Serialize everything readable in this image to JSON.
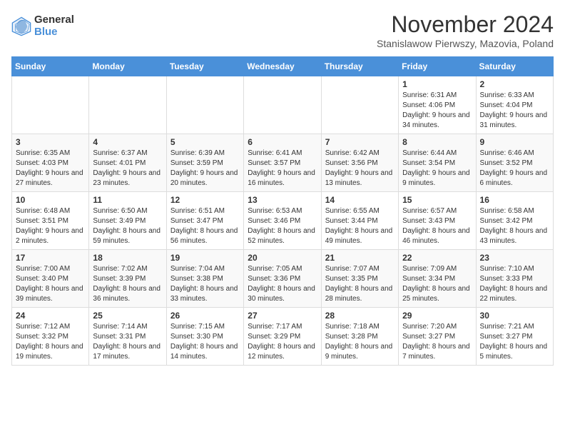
{
  "logo": {
    "general": "General",
    "blue": "Blue"
  },
  "title": "November 2024",
  "subtitle": "Stanislawow Pierwszy, Mazovia, Poland",
  "headers": [
    "Sunday",
    "Monday",
    "Tuesday",
    "Wednesday",
    "Thursday",
    "Friday",
    "Saturday"
  ],
  "weeks": [
    [
      {
        "day": "",
        "info": ""
      },
      {
        "day": "",
        "info": ""
      },
      {
        "day": "",
        "info": ""
      },
      {
        "day": "",
        "info": ""
      },
      {
        "day": "",
        "info": ""
      },
      {
        "day": "1",
        "info": "Sunrise: 6:31 AM\nSunset: 4:06 PM\nDaylight: 9 hours and 34 minutes."
      },
      {
        "day": "2",
        "info": "Sunrise: 6:33 AM\nSunset: 4:04 PM\nDaylight: 9 hours and 31 minutes."
      }
    ],
    [
      {
        "day": "3",
        "info": "Sunrise: 6:35 AM\nSunset: 4:03 PM\nDaylight: 9 hours and 27 minutes."
      },
      {
        "day": "4",
        "info": "Sunrise: 6:37 AM\nSunset: 4:01 PM\nDaylight: 9 hours and 23 minutes."
      },
      {
        "day": "5",
        "info": "Sunrise: 6:39 AM\nSunset: 3:59 PM\nDaylight: 9 hours and 20 minutes."
      },
      {
        "day": "6",
        "info": "Sunrise: 6:41 AM\nSunset: 3:57 PM\nDaylight: 9 hours and 16 minutes."
      },
      {
        "day": "7",
        "info": "Sunrise: 6:42 AM\nSunset: 3:56 PM\nDaylight: 9 hours and 13 minutes."
      },
      {
        "day": "8",
        "info": "Sunrise: 6:44 AM\nSunset: 3:54 PM\nDaylight: 9 hours and 9 minutes."
      },
      {
        "day": "9",
        "info": "Sunrise: 6:46 AM\nSunset: 3:52 PM\nDaylight: 9 hours and 6 minutes."
      }
    ],
    [
      {
        "day": "10",
        "info": "Sunrise: 6:48 AM\nSunset: 3:51 PM\nDaylight: 9 hours and 2 minutes."
      },
      {
        "day": "11",
        "info": "Sunrise: 6:50 AM\nSunset: 3:49 PM\nDaylight: 8 hours and 59 minutes."
      },
      {
        "day": "12",
        "info": "Sunrise: 6:51 AM\nSunset: 3:47 PM\nDaylight: 8 hours and 56 minutes."
      },
      {
        "day": "13",
        "info": "Sunrise: 6:53 AM\nSunset: 3:46 PM\nDaylight: 8 hours and 52 minutes."
      },
      {
        "day": "14",
        "info": "Sunrise: 6:55 AM\nSunset: 3:44 PM\nDaylight: 8 hours and 49 minutes."
      },
      {
        "day": "15",
        "info": "Sunrise: 6:57 AM\nSunset: 3:43 PM\nDaylight: 8 hours and 46 minutes."
      },
      {
        "day": "16",
        "info": "Sunrise: 6:58 AM\nSunset: 3:42 PM\nDaylight: 8 hours and 43 minutes."
      }
    ],
    [
      {
        "day": "17",
        "info": "Sunrise: 7:00 AM\nSunset: 3:40 PM\nDaylight: 8 hours and 39 minutes."
      },
      {
        "day": "18",
        "info": "Sunrise: 7:02 AM\nSunset: 3:39 PM\nDaylight: 8 hours and 36 minutes."
      },
      {
        "day": "19",
        "info": "Sunrise: 7:04 AM\nSunset: 3:38 PM\nDaylight: 8 hours and 33 minutes."
      },
      {
        "day": "20",
        "info": "Sunrise: 7:05 AM\nSunset: 3:36 PM\nDaylight: 8 hours and 30 minutes."
      },
      {
        "day": "21",
        "info": "Sunrise: 7:07 AM\nSunset: 3:35 PM\nDaylight: 8 hours and 28 minutes."
      },
      {
        "day": "22",
        "info": "Sunrise: 7:09 AM\nSunset: 3:34 PM\nDaylight: 8 hours and 25 minutes."
      },
      {
        "day": "23",
        "info": "Sunrise: 7:10 AM\nSunset: 3:33 PM\nDaylight: 8 hours and 22 minutes."
      }
    ],
    [
      {
        "day": "24",
        "info": "Sunrise: 7:12 AM\nSunset: 3:32 PM\nDaylight: 8 hours and 19 minutes."
      },
      {
        "day": "25",
        "info": "Sunrise: 7:14 AM\nSunset: 3:31 PM\nDaylight: 8 hours and 17 minutes."
      },
      {
        "day": "26",
        "info": "Sunrise: 7:15 AM\nSunset: 3:30 PM\nDaylight: 8 hours and 14 minutes."
      },
      {
        "day": "27",
        "info": "Sunrise: 7:17 AM\nSunset: 3:29 PM\nDaylight: 8 hours and 12 minutes."
      },
      {
        "day": "28",
        "info": "Sunrise: 7:18 AM\nSunset: 3:28 PM\nDaylight: 8 hours and 9 minutes."
      },
      {
        "day": "29",
        "info": "Sunrise: 7:20 AM\nSunset: 3:27 PM\nDaylight: 8 hours and 7 minutes."
      },
      {
        "day": "30",
        "info": "Sunrise: 7:21 AM\nSunset: 3:27 PM\nDaylight: 8 hours and 5 minutes."
      }
    ]
  ]
}
